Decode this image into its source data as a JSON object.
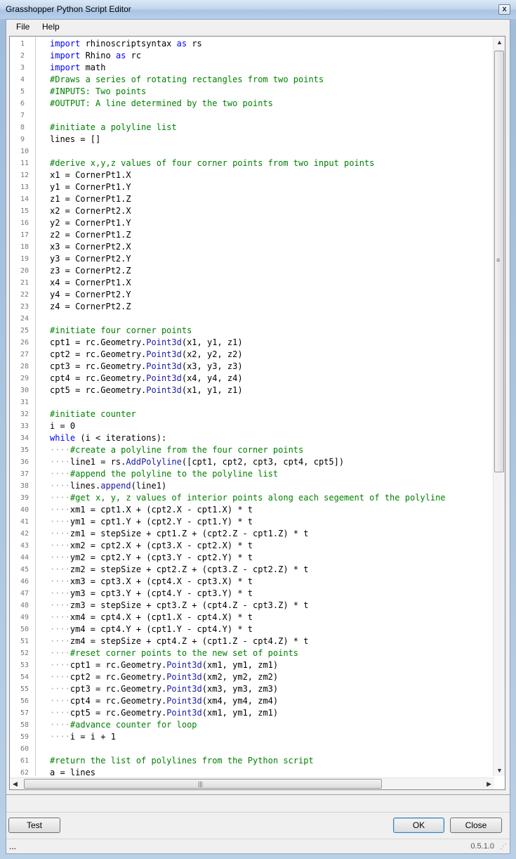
{
  "window": {
    "title": "Grasshopper Python Script Editor",
    "close_glyph": "x"
  },
  "menu": {
    "items": [
      "File",
      "Help"
    ]
  },
  "editor": {
    "lines": [
      [
        [
          0,
          "kw",
          "import"
        ],
        [
          0,
          "t",
          " rhinoscriptsyntax "
        ],
        [
          0,
          "kw",
          "as"
        ],
        [
          0,
          "t",
          " rs"
        ]
      ],
      [
        [
          0,
          "kw",
          "import"
        ],
        [
          0,
          "t",
          " Rhino "
        ],
        [
          0,
          "kw",
          "as"
        ],
        [
          0,
          "t",
          " rc"
        ]
      ],
      [
        [
          0,
          "kw",
          "import"
        ],
        [
          0,
          "t",
          " math"
        ]
      ],
      [
        [
          0,
          "cm",
          "#Draws a series of rotating rectangles from two points"
        ]
      ],
      [
        [
          0,
          "cm",
          "#INPUTS: Two points"
        ]
      ],
      [
        [
          0,
          "cm",
          "#OUTPUT: A line determined by the two points"
        ]
      ],
      [],
      [
        [
          0,
          "cm",
          "#initiate a polyline list"
        ]
      ],
      [
        [
          0,
          "t",
          "lines = []"
        ]
      ],
      [],
      [
        [
          0,
          "cm",
          "#derive x,y,z values of four corner points from two input points"
        ]
      ],
      [
        [
          0,
          "t",
          "x1 = CornerPt1.X"
        ]
      ],
      [
        [
          0,
          "t",
          "y1 = CornerPt1.Y"
        ]
      ],
      [
        [
          0,
          "t",
          "z1 = CornerPt1.Z"
        ]
      ],
      [
        [
          0,
          "t",
          "x2 = CornerPt2.X"
        ]
      ],
      [
        [
          0,
          "t",
          "y2 = CornerPt1.Y"
        ]
      ],
      [
        [
          0,
          "t",
          "z2 = CornerPt1.Z"
        ]
      ],
      [
        [
          0,
          "t",
          "x3 = CornerPt2.X"
        ]
      ],
      [
        [
          0,
          "t",
          "y3 = CornerPt2.Y"
        ]
      ],
      [
        [
          0,
          "t",
          "z3 = CornerPt2.Z"
        ]
      ],
      [
        [
          0,
          "t",
          "x4 = CornerPt1.X"
        ]
      ],
      [
        [
          0,
          "t",
          "y4 = CornerPt2.Y"
        ]
      ],
      [
        [
          0,
          "t",
          "z4 = CornerPt2.Z"
        ]
      ],
      [],
      [
        [
          0,
          "cm",
          "#initiate four corner points"
        ]
      ],
      [
        [
          0,
          "t",
          "cpt1 = rc.Geometry."
        ],
        [
          0,
          "fn",
          "Point3d"
        ],
        [
          0,
          "t",
          "(x1, y1, z1)"
        ]
      ],
      [
        [
          0,
          "t",
          "cpt2 = rc.Geometry."
        ],
        [
          0,
          "fn",
          "Point3d"
        ],
        [
          0,
          "t",
          "(x2, y2, z2)"
        ]
      ],
      [
        [
          0,
          "t",
          "cpt3 = rc.Geometry."
        ],
        [
          0,
          "fn",
          "Point3d"
        ],
        [
          0,
          "t",
          "(x3, y3, z3)"
        ]
      ],
      [
        [
          0,
          "t",
          "cpt4 = rc.Geometry."
        ],
        [
          0,
          "fn",
          "Point3d"
        ],
        [
          0,
          "t",
          "(x4, y4, z4)"
        ]
      ],
      [
        [
          0,
          "t",
          "cpt5 = rc.Geometry."
        ],
        [
          0,
          "fn",
          "Point3d"
        ],
        [
          0,
          "t",
          "(x1, y1, z1)"
        ]
      ],
      [],
      [
        [
          0,
          "cm",
          "#initiate counter"
        ]
      ],
      [
        [
          0,
          "t",
          "i = 0"
        ]
      ],
      [
        [
          0,
          "kw",
          "while"
        ],
        [
          0,
          "t",
          " (i < iterations):"
        ]
      ],
      [
        [
          1,
          "ws",
          "····"
        ],
        [
          0,
          "cm",
          "#create a polyline from the four corner points"
        ]
      ],
      [
        [
          1,
          "ws",
          "····"
        ],
        [
          0,
          "t",
          "line1 = rs."
        ],
        [
          0,
          "fn",
          "AddPolyline"
        ],
        [
          0,
          "t",
          "([cpt1, cpt2, cpt3, cpt4, cpt5])"
        ]
      ],
      [
        [
          1,
          "ws",
          "····"
        ],
        [
          0,
          "cm",
          "#append the polyline to the polyline list"
        ]
      ],
      [
        [
          1,
          "ws",
          "····"
        ],
        [
          0,
          "t",
          "lines."
        ],
        [
          0,
          "fn",
          "append"
        ],
        [
          0,
          "t",
          "(line1)"
        ]
      ],
      [
        [
          1,
          "ws",
          "····"
        ],
        [
          0,
          "cm",
          "#get x, y, z values of interior points along each segement of the polyline"
        ]
      ],
      [
        [
          1,
          "ws",
          "····"
        ],
        [
          0,
          "t",
          "xm1 = cpt1.X + (cpt2.X - cpt1.X) * t"
        ]
      ],
      [
        [
          1,
          "ws",
          "····"
        ],
        [
          0,
          "t",
          "ym1 = cpt1.Y + (cpt2.Y - cpt1.Y) * t"
        ]
      ],
      [
        [
          1,
          "ws",
          "····"
        ],
        [
          0,
          "t",
          "zm1 = stepSize + cpt1.Z + (cpt2.Z - cpt1.Z) * t"
        ]
      ],
      [
        [
          1,
          "ws",
          "····"
        ],
        [
          0,
          "t",
          "xm2 = cpt2.X + (cpt3.X - cpt2.X) * t"
        ]
      ],
      [
        [
          1,
          "ws",
          "····"
        ],
        [
          0,
          "t",
          "ym2 = cpt2.Y + (cpt3.Y - cpt2.Y) * t"
        ]
      ],
      [
        [
          1,
          "ws",
          "····"
        ],
        [
          0,
          "t",
          "zm2 = stepSize + cpt2.Z + (cpt3.Z - cpt2.Z) * t"
        ]
      ],
      [
        [
          1,
          "ws",
          "····"
        ],
        [
          0,
          "t",
          "xm3 = cpt3.X + (cpt4.X - cpt3.X) * t"
        ]
      ],
      [
        [
          1,
          "ws",
          "····"
        ],
        [
          0,
          "t",
          "ym3 = cpt3.Y + (cpt4.Y - cpt3.Y) * t"
        ]
      ],
      [
        [
          1,
          "ws",
          "····"
        ],
        [
          0,
          "t",
          "zm3 = stepSize + cpt3.Z + (cpt4.Z - cpt3.Z) * t"
        ]
      ],
      [
        [
          1,
          "ws",
          "····"
        ],
        [
          0,
          "t",
          "xm4 = cpt4.X + (cpt1.X - cpt4.X) * t"
        ]
      ],
      [
        [
          1,
          "ws",
          "····"
        ],
        [
          0,
          "t",
          "ym4 = cpt4.Y + (cpt1.Y - cpt4.Y) * t"
        ]
      ],
      [
        [
          1,
          "ws",
          "····"
        ],
        [
          0,
          "t",
          "zm4 = stepSize + cpt4.Z + (cpt1.Z - cpt4.Z) * t"
        ]
      ],
      [
        [
          1,
          "ws",
          "····"
        ],
        [
          0,
          "cm",
          "#reset corner points to the new set of points"
        ]
      ],
      [
        [
          1,
          "ws",
          "····"
        ],
        [
          0,
          "t",
          "cpt1 = rc.Geometry."
        ],
        [
          0,
          "fn",
          "Point3d"
        ],
        [
          0,
          "t",
          "(xm1, ym1, zm1)"
        ]
      ],
      [
        [
          1,
          "ws",
          "····"
        ],
        [
          0,
          "t",
          "cpt2 = rc.Geometry."
        ],
        [
          0,
          "fn",
          "Point3d"
        ],
        [
          0,
          "t",
          "(xm2, ym2, zm2)"
        ]
      ],
      [
        [
          1,
          "ws",
          "····"
        ],
        [
          0,
          "t",
          "cpt3 = rc.Geometry."
        ],
        [
          0,
          "fn",
          "Point3d"
        ],
        [
          0,
          "t",
          "(xm3, ym3, zm3)"
        ]
      ],
      [
        [
          1,
          "ws",
          "····"
        ],
        [
          0,
          "t",
          "cpt4 = rc.Geometry."
        ],
        [
          0,
          "fn",
          "Point3d"
        ],
        [
          0,
          "t",
          "(xm4, ym4, zm4)"
        ]
      ],
      [
        [
          1,
          "ws",
          "····"
        ],
        [
          0,
          "t",
          "cpt5 = rc.Geometry."
        ],
        [
          0,
          "fn",
          "Point3d"
        ],
        [
          0,
          "t",
          "(xm1, ym1, zm1)"
        ]
      ],
      [
        [
          1,
          "ws",
          "····"
        ],
        [
          0,
          "cm",
          "#advance counter for loop"
        ]
      ],
      [
        [
          1,
          "ws",
          "····"
        ],
        [
          0,
          "t",
          "i = i + 1"
        ]
      ],
      [],
      [
        [
          0,
          "cm",
          "#return the list of polylines from the Python script"
        ]
      ],
      [
        [
          0,
          "t",
          "a = lines"
        ]
      ]
    ],
    "scroll_up_glyph": "▲",
    "scroll_down_glyph": "▼",
    "scroll_left_glyph": "◀",
    "scroll_right_glyph": "▶",
    "grip_glyph": "≡",
    "hgrip_glyph": "|||"
  },
  "buttons": {
    "test": "Test",
    "ok": "OK",
    "close": "Close"
  },
  "status": {
    "left": "...",
    "version": "0.5.1.0",
    "grip": "⋰"
  }
}
